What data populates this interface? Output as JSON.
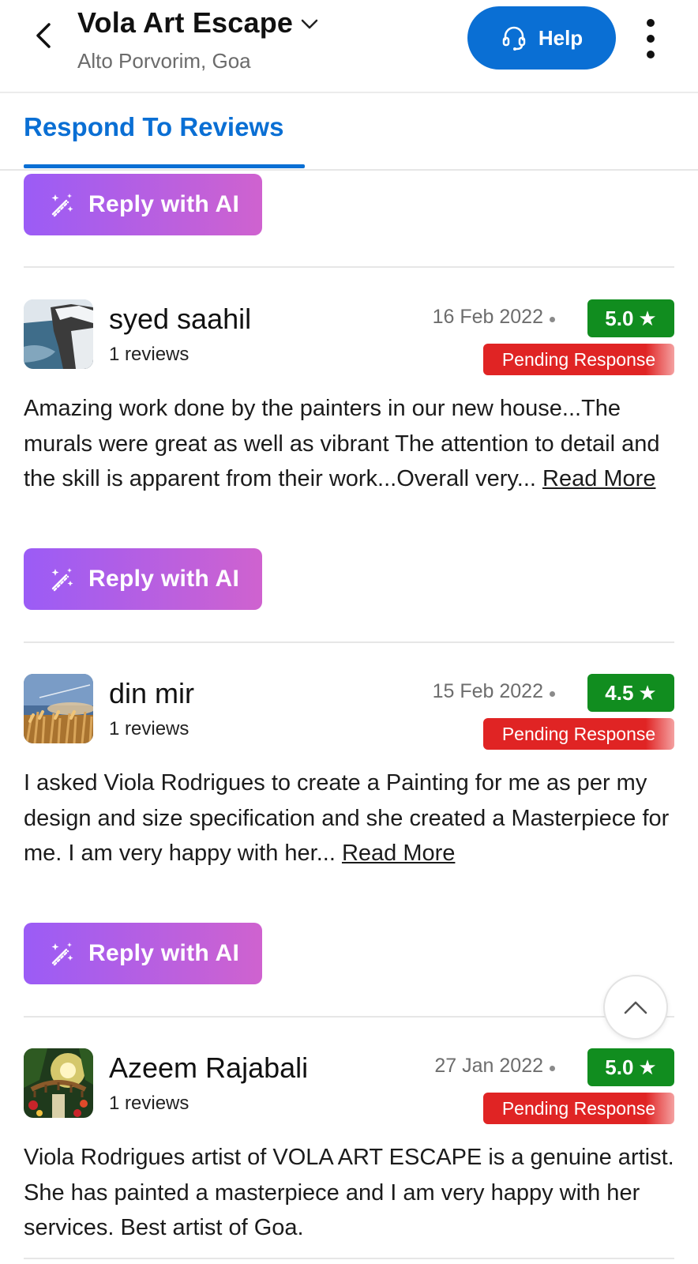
{
  "header": {
    "title": "Vola Art Escape",
    "subtitle": "Alto Porvorim, Goa",
    "help_label": "Help"
  },
  "tabs": {
    "active_label": "Respond To Reviews"
  },
  "ai_button_label": "Reply with AI",
  "reviews": [
    {
      "name": "syed saahil",
      "count": "1 reviews",
      "date": "16 Feb 2022",
      "rating": "5.0",
      "status": "Pending Response",
      "text": "Amazing work done by the painters in our new house...The murals were great as well as vibrant The attention to detail and the skill is apparent from their work...Overall very...",
      "read_more": "Read More"
    },
    {
      "name": "din mir",
      "count": "1 reviews",
      "date": "15 Feb 2022",
      "rating": "4.5",
      "status": "Pending Response",
      "text": "I asked Viola Rodrigues to create a Painting for me as per my design and size specification and she created a Masterpiece for me. I am very happy with her...",
      "read_more": "Read More"
    },
    {
      "name": "Azeem Rajabali",
      "count": "1 reviews",
      "date": "27 Jan 2022",
      "rating": "5.0",
      "status": "Pending Response",
      "text": "Viola Rodrigues artist of VOLA ART ESCAPE is a genuine artist. She has painted a masterpiece and I am very happy with her services. Best artist of Goa.",
      "read_more": ""
    }
  ],
  "colors": {
    "primary": "#0a6fd4",
    "rating_green": "#118d1f",
    "pending_red": "#e02424",
    "ai_gradient_start": "#9b5cf6",
    "ai_gradient_end": "#cf62cf"
  },
  "icons": {
    "back": "arrow-left-icon",
    "dropdown": "chevron-down-icon",
    "help": "headset-icon",
    "menu": "more-vertical-icon",
    "ai": "magic-wand-icon",
    "star": "star-icon",
    "scroll_top": "chevron-up-icon"
  }
}
